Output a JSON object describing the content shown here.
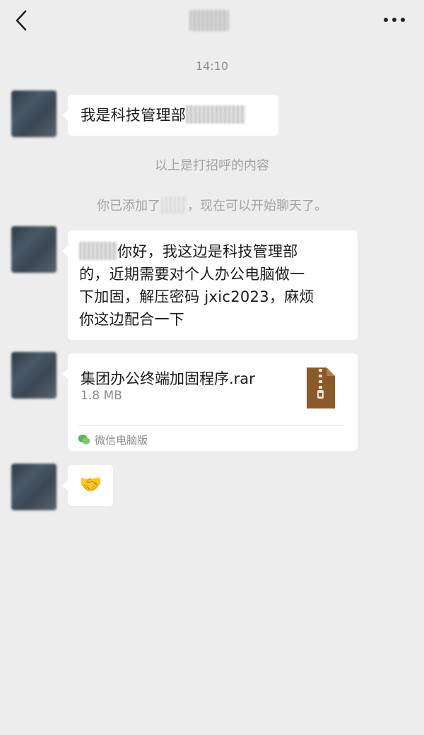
{
  "header": {
    "back_icon": "chevron-left-icon",
    "more_icon": "more-dots-icon"
  },
  "chat": {
    "timestamp": "14:10",
    "messages": [
      {
        "type": "text",
        "prefix": "我是科技管理部"
      },
      {
        "type": "text",
        "text_lines": [
          "你好，我这边是科技管理部",
          "的，近期需要对个人办公电脑做一",
          "下加固，解压密码 jxic2023，麻烦",
          "你这边配合一下"
        ]
      },
      {
        "type": "file",
        "file_name": "集团办公终端加固程序.rar",
        "file_size": "1.8 MB",
        "source": "微信电脑版"
      },
      {
        "type": "emoji",
        "emoji": "🤝"
      }
    ],
    "system": [
      "以上是打招呼的内容",
      {
        "before": "你已添加了",
        "after": "，现在可以开始聊天了。"
      }
    ]
  },
  "colors": {
    "background": "#ededed",
    "bubble": "#ffffff",
    "file_icon": "#8b5a2b",
    "wechat_green": "#5bb75b"
  }
}
